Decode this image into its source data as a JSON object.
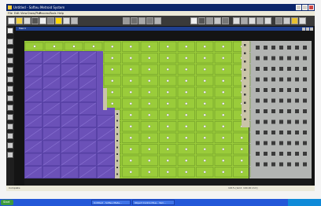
{
  "window": {
    "title": "Untitled - Softeu Metroid System",
    "menu": [
      "File",
      "Edit",
      "View",
      "Draw/Plot",
      "Process",
      "Tools",
      "Help"
    ]
  },
  "document": {
    "title": "Main1"
  },
  "status": {
    "left": "Complete",
    "right": "101% [Grid: 100.00 mm]"
  },
  "taskbar": {
    "start_label": "Start",
    "tasks": [
      "Untitled - Softeu Meta...",
      "Object Control Bus - Yam..."
    ]
  },
  "colors": {
    "purple": "#6b51b8",
    "green": "#9acc3a",
    "frame": "#b2b4b2",
    "dark": "#2a2a2a"
  }
}
